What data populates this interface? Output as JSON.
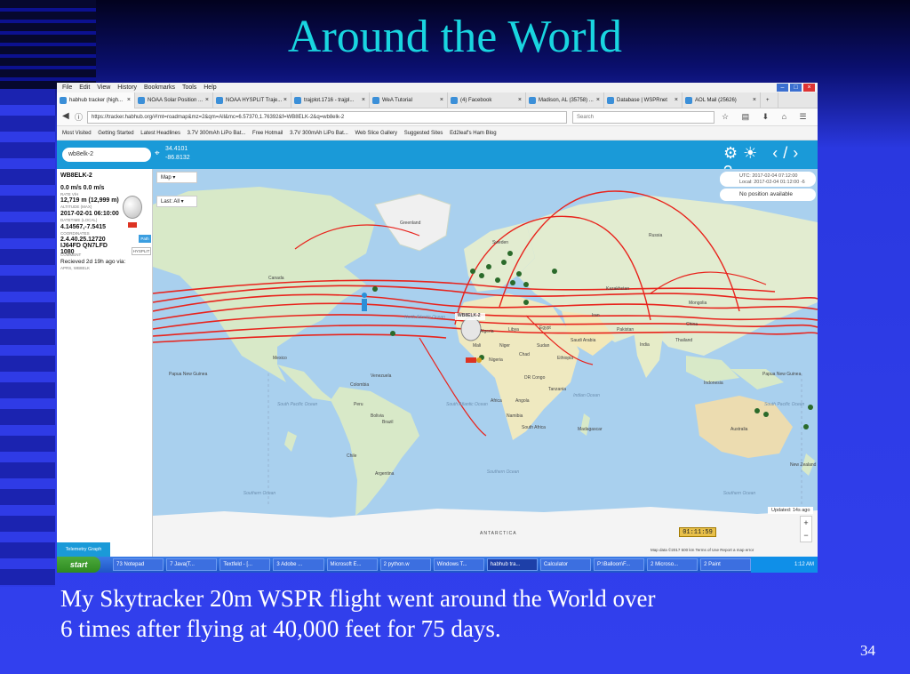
{
  "slide": {
    "title": "Around the World",
    "caption_line1": "My Skytracker 20m WSPR flight went around the World over",
    "caption_line2": "6 times after flying at 40,000 feet for 75 days.",
    "page_number": "34"
  },
  "browser": {
    "menu": [
      "File",
      "Edit",
      "View",
      "History",
      "Bookmarks",
      "Tools",
      "Help"
    ],
    "tabs": [
      {
        "label": "habhub tracker (high..."
      },
      {
        "label": "NOAA Solar Position ..."
      },
      {
        "label": "NOAA HYSPLIT Traje..."
      },
      {
        "label": "trajplot.1716 - trajpl..."
      },
      {
        "label": "WeA Tutorial"
      },
      {
        "label": "(4) Facebook"
      },
      {
        "label": "Madison, AL (35758) ..."
      },
      {
        "label": "Database | WSPRnet"
      },
      {
        "label": "AOL Mail (25626)"
      }
    ],
    "url": "https://tracker.habhub.org/#!mt=roadmap&mz=2&qm=All&mc=6.57370,1.76392&f=WB8ELK-2&q=wb8elk-2",
    "search_placeholder": "Search",
    "bookmarks": [
      "Most Visited",
      "Getting Started",
      "Latest Headlines",
      "3.7V 300mAh LiPo Bat...",
      "Free Hotmail",
      "3.7V 300mAh LiPo Bat...",
      "Web Slice Gallery",
      "Suggested Sites",
      "Ed2leaf's Ham Blog"
    ]
  },
  "tracker": {
    "callsign_input": "wb8elk-2",
    "lat": "34.4101",
    "lon": "-86.8132",
    "panel_callsign": "WB8ELK-2",
    "speed": "0.0 m/s 0.0 m/s",
    "speed_label": "RATE V/H",
    "altitude": "12,719 m (12,999 m)",
    "altitude_label": "ALTITUDE (MAX)",
    "datetime": "2017-02-01 06:10:00",
    "datetime_label": "DATETIME (LOCAL)",
    "coords": "4.14567,-7.5415",
    "coords_label": "COORDINATES",
    "comment": "2.4.40.25.12720 IJ64FD QN7LFD 1080",
    "comment_label": "COMMENT",
    "received": "Recieved 2d 19h ago via:",
    "received_via": "APRS, WB8ELK",
    "hysplit_btn": "HYSPLIT",
    "path_btn": "Path",
    "map_type": "Map",
    "last_filter": "Last: All",
    "utc_line": "UTC: 2017-02-04 07:12:00",
    "local_line": "Local: 2017-02-04 01:12:00 -6",
    "no_position": "No position available",
    "updated": "Updated: 14s ago",
    "clock": "01:11:59",
    "map_data": "Map data ©2017   500 km        Terms of Use   Report a map error",
    "telemetry_btn": "Telemetry Graph",
    "balloon_marker_label": "WB8ELK-2"
  },
  "map_labels": {
    "greenland": "Greenland",
    "russia": "Russia",
    "canada": "Canada",
    "north_atlantic": "North Atlantic Ocean",
    "mongolia": "Mongolia",
    "china": "China",
    "mexico": "Mexico",
    "india": "India",
    "africa": "Africa",
    "brazil": "Brazil",
    "australia": "Australia",
    "south_pacific_left": "South Pacific Ocean",
    "south_atlantic": "South Atlantic Ocean",
    "indian_ocean": "Indian Ocean",
    "south_pacific_right": "South Pacific Ocean",
    "southern_ocean_left": "Southern Ocean",
    "southern_ocean_mid": "Southern Ocean",
    "southern_ocean_right": "Southern Ocean",
    "antarctica": "ANTARCTICA",
    "new_zealand": "New Zealand",
    "argentina": "Argentina",
    "sweden": "Sweden",
    "kazakhstan": "Kazakhstan",
    "iran": "Iran",
    "algeria": "Algeria",
    "libya": "Libya",
    "sudan": "Sudan",
    "ethiopia": "Ethiopia",
    "dr_congo": "DR Congo",
    "tanzania": "Tanzania",
    "angola": "Angola",
    "namibia": "Namibia",
    "south_africa": "South Africa",
    "peru": "Peru",
    "bolivia": "Bolivia",
    "colombia": "Colombia",
    "venezuela": "Venezuela",
    "indonesia": "Indonesia",
    "png_left": "Papua New Guinea",
    "png_right": "Papua New Guinea",
    "thailand": "Thailand",
    "pakistan": "Pakistan",
    "saudi_arabia": "Saudi Arabia",
    "mali": "Mali",
    "niger": "Niger",
    "nigeria": "Nigeria",
    "chad": "Chad",
    "egypt": "Egypt",
    "madagascar": "Madagascar",
    "chile": "Chile"
  },
  "taskbar": {
    "start": "start",
    "tasks": [
      "73 Notepad",
      "7 Java(T...",
      "Textfeld - [...",
      "3 Adobe ...",
      "Microsoft E...",
      "2 python.w",
      "Windows T...",
      "habhub tra...",
      "Calculator",
      "P:\\Balloon\\F...",
      "2 Microso...",
      "2 Paint"
    ],
    "clock": "1:12 AM"
  },
  "colors": {
    "title": "#19d5e0",
    "track": "#e8231c",
    "tracker_bar": "#1a9ad8"
  }
}
